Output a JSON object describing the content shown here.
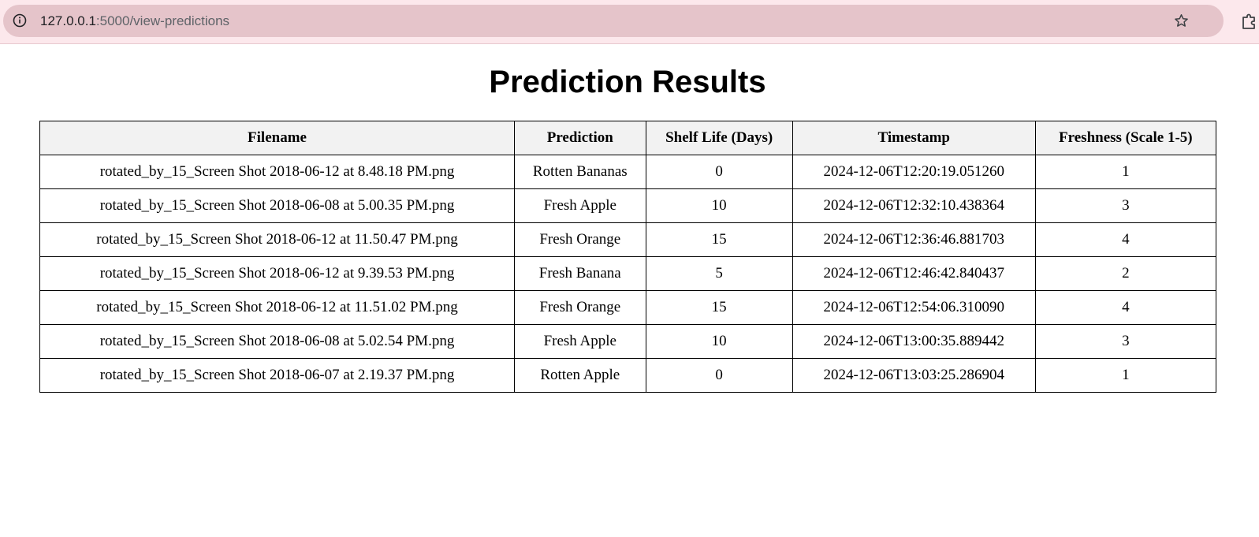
{
  "browser": {
    "url_host": "127.0.0.1",
    "url_path": ":5000/view-predictions"
  },
  "page": {
    "title": "Prediction Results"
  },
  "table": {
    "columns": [
      "Filename",
      "Prediction",
      "Shelf Life (Days)",
      "Timestamp",
      "Freshness (Scale 1-5)"
    ],
    "rows": [
      [
        "rotated_by_15_Screen Shot 2018-06-12 at 8.48.18 PM.png",
        "Rotten Bananas",
        "0",
        "2024-12-06T12:20:19.051260",
        "1"
      ],
      [
        "rotated_by_15_Screen Shot 2018-06-08 at 5.00.35 PM.png",
        "Fresh Apple",
        "10",
        "2024-12-06T12:32:10.438364",
        "3"
      ],
      [
        "rotated_by_15_Screen Shot 2018-06-12 at 11.50.47 PM.png",
        "Fresh Orange",
        "15",
        "2024-12-06T12:36:46.881703",
        "4"
      ],
      [
        "rotated_by_15_Screen Shot 2018-06-12 at 9.39.53 PM.png",
        "Fresh Banana",
        "5",
        "2024-12-06T12:46:42.840437",
        "2"
      ],
      [
        "rotated_by_15_Screen Shot 2018-06-12 at 11.51.02 PM.png",
        "Fresh Orange",
        "15",
        "2024-12-06T12:54:06.310090",
        "4"
      ],
      [
        "rotated_by_15_Screen Shot 2018-06-08 at 5.02.54 PM.png",
        "Fresh Apple",
        "10",
        "2024-12-06T13:00:35.889442",
        "3"
      ],
      [
        "rotated_by_15_Screen Shot 2018-06-07 at 2.19.37 PM.png",
        "Rotten Apple",
        "0",
        "2024-12-06T13:03:25.286904",
        "1"
      ]
    ]
  },
  "icons": {
    "site_info": "info-icon",
    "bookmark": "star-icon",
    "extensions": "puzzle-icon"
  },
  "colors": {
    "browser_bar": "#fce8ec",
    "omnibox": "#e5c4ca",
    "header_bg": "#f2f2f2"
  }
}
